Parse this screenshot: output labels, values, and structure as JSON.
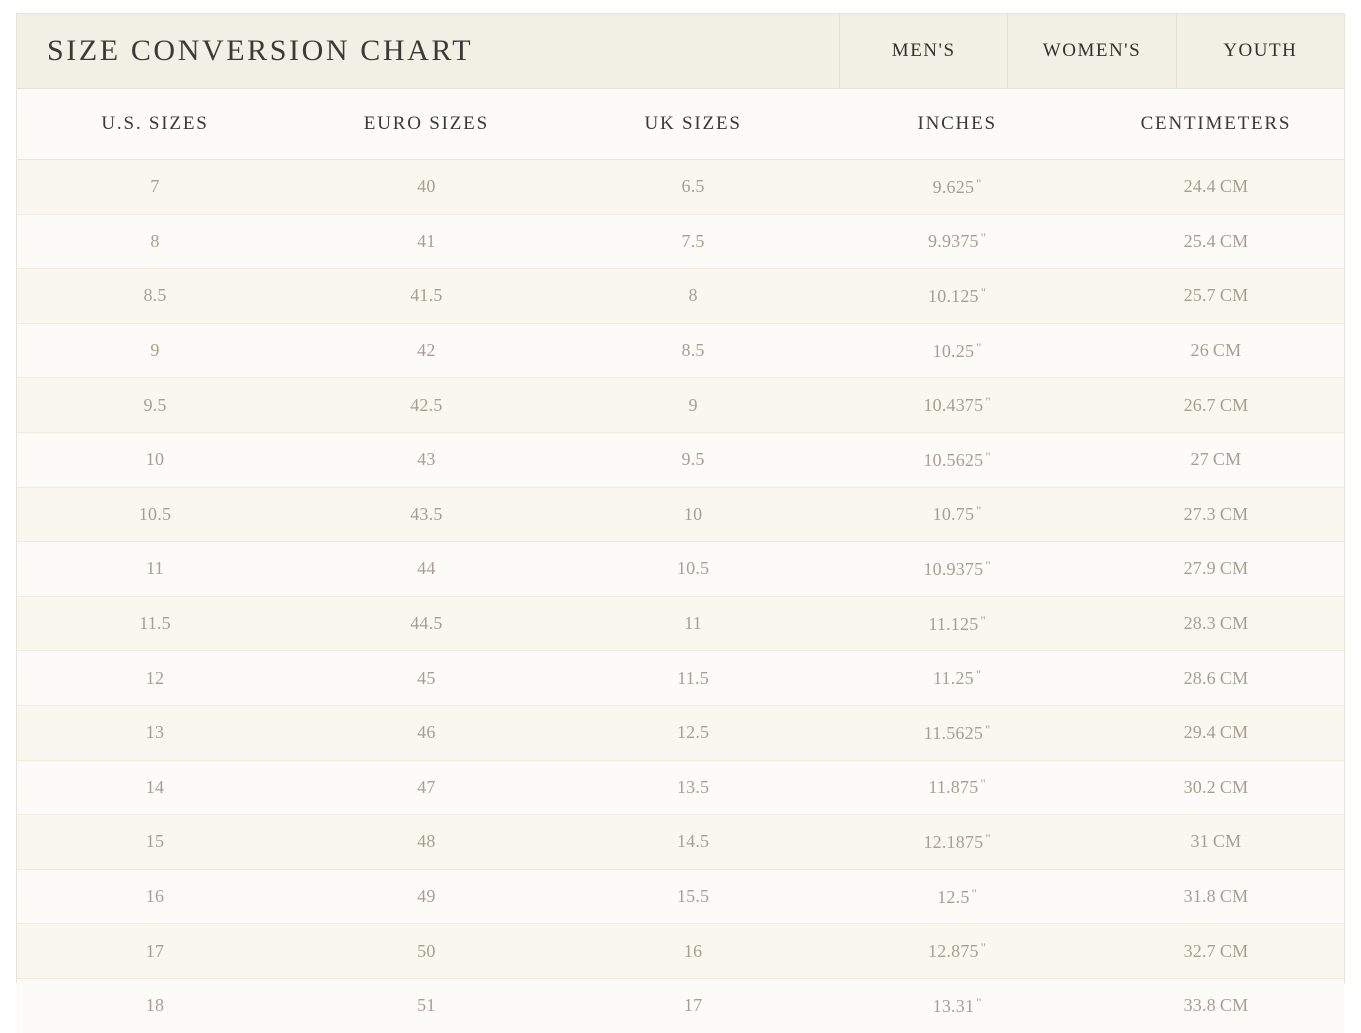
{
  "header": {
    "title": "SIZE CONVERSION CHART",
    "tabs": [
      {
        "id": "mens",
        "label": "MEN'S"
      },
      {
        "id": "womens",
        "label": "WOMEN'S"
      },
      {
        "id": "youth",
        "label": "YOUTH"
      }
    ],
    "active_tab": "mens"
  },
  "table": {
    "columns": [
      {
        "key": "us",
        "label": "U.S. SIZES"
      },
      {
        "key": "euro",
        "label": "EURO SIZES"
      },
      {
        "key": "uk",
        "label": "UK SIZES"
      },
      {
        "key": "in",
        "label": "INCHES"
      },
      {
        "key": "cm",
        "label": "CENTIMETERS"
      }
    ],
    "inch_symbol": "\"",
    "cm_suffix": "CM",
    "rows": [
      {
        "us": "7",
        "euro": "40",
        "uk": "6.5",
        "inches": "9.625",
        "cm": "24.4"
      },
      {
        "us": "8",
        "euro": "41",
        "uk": "7.5",
        "inches": "9.9375",
        "cm": "25.4"
      },
      {
        "us": "8.5",
        "euro": "41.5",
        "uk": "8",
        "inches": "10.125",
        "cm": "25.7"
      },
      {
        "us": "9",
        "euro": "42",
        "uk": "8.5",
        "inches": "10.25",
        "cm": "26"
      },
      {
        "us": "9.5",
        "euro": "42.5",
        "uk": "9",
        "inches": "10.4375",
        "cm": "26.7"
      },
      {
        "us": "10",
        "euro": "43",
        "uk": "9.5",
        "inches": "10.5625",
        "cm": "27"
      },
      {
        "us": "10.5",
        "euro": "43.5",
        "uk": "10",
        "inches": "10.75",
        "cm": "27.3"
      },
      {
        "us": "11",
        "euro": "44",
        "uk": "10.5",
        "inches": "10.9375",
        "cm": "27.9"
      },
      {
        "us": "11.5",
        "euro": "44.5",
        "uk": "11",
        "inches": "11.125",
        "cm": "28.3"
      },
      {
        "us": "12",
        "euro": "45",
        "uk": "11.5",
        "inches": "11.25",
        "cm": "28.6"
      },
      {
        "us": "13",
        "euro": "46",
        "uk": "12.5",
        "inches": "11.5625",
        "cm": "29.4"
      },
      {
        "us": "14",
        "euro": "47",
        "uk": "13.5",
        "inches": "11.875",
        "cm": "30.2"
      },
      {
        "us": "15",
        "euro": "48",
        "uk": "14.5",
        "inches": "12.1875",
        "cm": "31"
      },
      {
        "us": "16",
        "euro": "49",
        "uk": "15.5",
        "inches": "12.5",
        "cm": "31.8"
      },
      {
        "us": "17",
        "euro": "50",
        "uk": "16",
        "inches": "12.875",
        "cm": "32.7"
      },
      {
        "us": "18",
        "euro": "51",
        "uk": "17",
        "inches": "13.31",
        "cm": "33.8"
      }
    ]
  },
  "colors": {
    "header_band": "#f2efe4",
    "page_background": "#ffffff",
    "row_odd": "#faf7ef",
    "row_even": "#fcfbf7",
    "border": "#e7e3d8",
    "heading_text": "#3b3935",
    "cell_text": "#a7a092"
  }
}
